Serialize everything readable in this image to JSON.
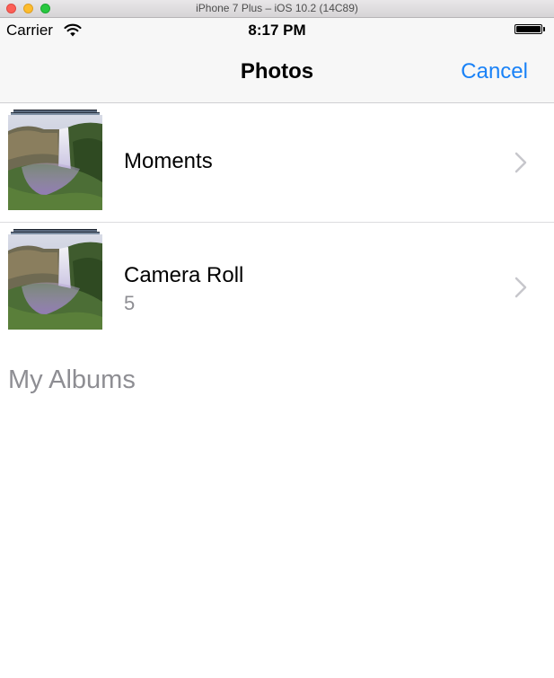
{
  "window": {
    "title": "iPhone 7 Plus – iOS 10.2 (14C89)"
  },
  "status_bar": {
    "carrier": "Carrier",
    "time": "8:17 PM",
    "wifi_icon": "wifi-icon",
    "battery_icon": "battery-icon",
    "battery_level": 1.0
  },
  "nav": {
    "title": "Photos",
    "cancel_label": "Cancel",
    "accent_color": "#1a82f7"
  },
  "albums": [
    {
      "name": "Moments",
      "count": "",
      "thumbnail": "waterfall-photo-thumbnail"
    },
    {
      "name": "Camera Roll",
      "count": "5",
      "thumbnail": "waterfall-photo-thumbnail"
    }
  ],
  "sections": {
    "my_albums": "My Albums"
  },
  "colors": {
    "secondary_text": "#8e8e93",
    "separator": "#dcdcdf",
    "bar_background": "#f7f7f7"
  }
}
